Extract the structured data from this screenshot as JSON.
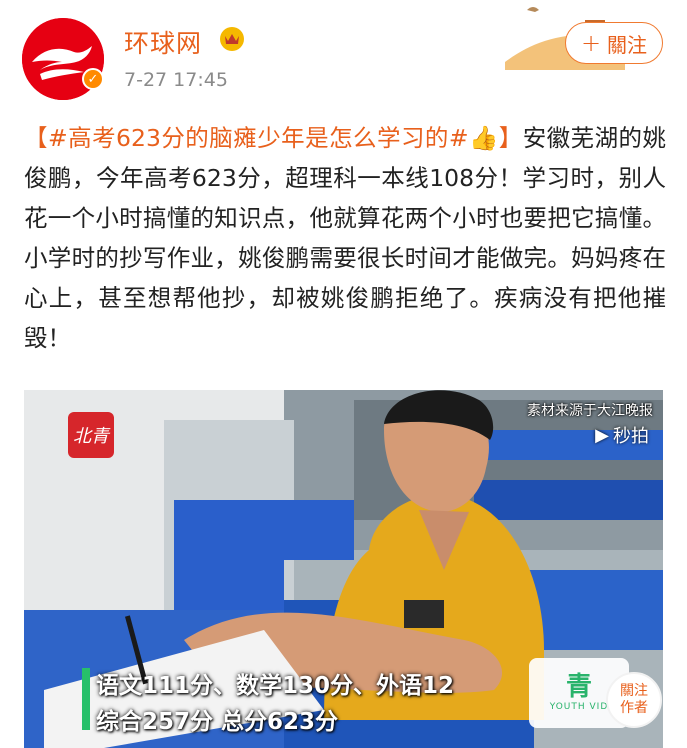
{
  "account": {
    "name": "环球网",
    "time": "7-27 17:45"
  },
  "follow_button": {
    "plus": "+",
    "label": "關注"
  },
  "post": {
    "hashtag": "#高考623分的脑瘫少年是怎么学习的#",
    "bracket_open": "【",
    "bracket_close": "】",
    "thumb": "👍",
    "body": "安徽芜湖的姚俊鹏，今年高考623分，超理科一本线108分！学习时，别人花一个小时搞懂的知识点，他就算花两个小时也要把它搞懂。小学时的抄写作业，姚俊鹏需要很长时间才能做完。妈妈疼在心上，甚至想帮他抄，却被姚俊鹏拒绝了。疾病没有把他摧毁！"
  },
  "video": {
    "logo_text": "北青",
    "source": "素材来源于大江晚报",
    "sub_source": "秒拍",
    "caption_line1": "语文111分、数学130分、外语12",
    "caption_line2": "综合257分 总分623分",
    "channel_cn": "青",
    "channel_en": "YOUTH VID",
    "follow_line1": "關注",
    "follow_line2": "作者"
  },
  "colors": {
    "accent": "#e8601c",
    "brand_red": "#e60012",
    "caption_green": "#27c06a"
  },
  "icons": [
    "avatar-logo-icon",
    "verified-icon",
    "crown-icon",
    "follow-plus-icon",
    "play-icon"
  ]
}
